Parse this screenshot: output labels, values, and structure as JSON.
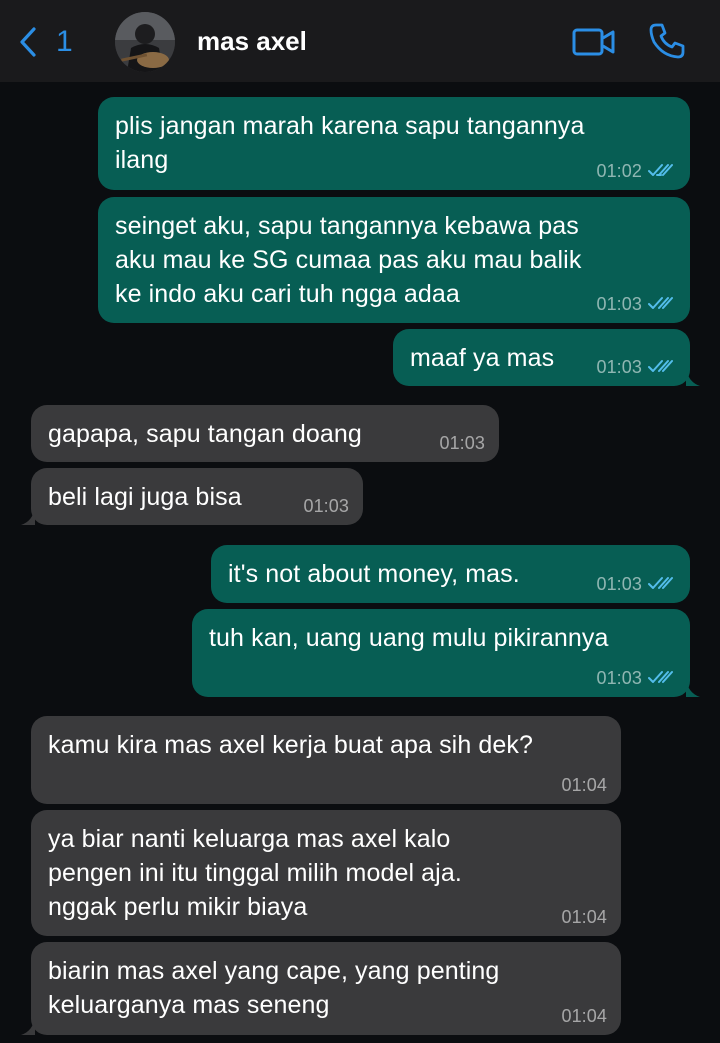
{
  "header": {
    "back_count": "1",
    "contact_name": "mas axel",
    "accent_color": "#2b8ee5",
    "icons": [
      "chevron-left-icon",
      "video-call-icon",
      "phone-icon"
    ]
  },
  "colors": {
    "background": "#0b0d10",
    "header_background": "#1a1a1c",
    "outgoing_bubble": "#075e54",
    "incoming_bubble": "#3a3a3c",
    "read_ticks": "#53bdeb"
  },
  "messages": [
    {
      "direction": "outgoing",
      "lines": [
        "plis jangan marah karena sapu tangannya",
        "ilang"
      ],
      "time": "01:02",
      "status": "read"
    },
    {
      "direction": "outgoing",
      "lines": [
        "seinget aku, sapu tangannya kebawa pas",
        "aku mau ke SG cumaa pas aku mau balik",
        "ke indo aku cari tuh ngga adaa"
      ],
      "time": "01:03",
      "status": "read"
    },
    {
      "direction": "outgoing",
      "lines": [
        "maaf ya mas"
      ],
      "time": "01:03",
      "status": "read"
    },
    {
      "direction": "incoming",
      "lines": [
        "gapapa, sapu tangan doang"
      ],
      "time": "01:03"
    },
    {
      "direction": "incoming",
      "lines": [
        "beli lagi juga bisa"
      ],
      "time": "01:03"
    },
    {
      "direction": "outgoing",
      "lines": [
        "it's not about money, mas."
      ],
      "time": "01:03",
      "status": "read"
    },
    {
      "direction": "outgoing",
      "lines": [
        "tuh kan, uang uang mulu pikirannya"
      ],
      "time": "01:03",
      "status": "read"
    },
    {
      "direction": "incoming",
      "lines": [
        "kamu kira mas axel kerja buat apa sih dek?"
      ],
      "time": "01:04"
    },
    {
      "direction": "incoming",
      "lines": [
        "ya biar nanti keluarga mas axel kalo",
        "pengen ini itu tinggal milih model aja.",
        "nggak perlu mikir biaya"
      ],
      "time": "01:04"
    },
    {
      "direction": "incoming",
      "lines": [
        "biarin mas axel yang cape, yang penting",
        "keluarganya mas seneng"
      ],
      "time": "01:04"
    }
  ]
}
